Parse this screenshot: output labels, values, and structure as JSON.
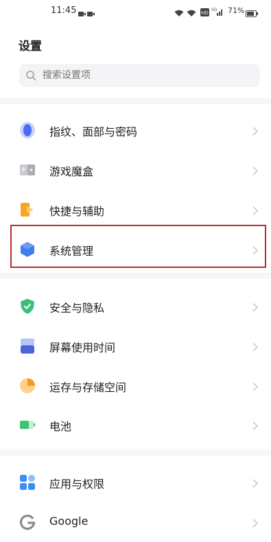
{
  "status_bar": {
    "time": "11:45",
    "battery_percent": "71%",
    "icons": [
      "video-record-icon",
      "wifi-icon",
      "wifi-icon",
      "hd-icon",
      "signal-5g-icon",
      "battery-icon"
    ]
  },
  "header": {
    "title": "设置"
  },
  "search": {
    "placeholder": "搜索设置项"
  },
  "groups": [
    {
      "items": [
        {
          "label": "指纹、面部与密码",
          "icon": "fingerprint-icon"
        },
        {
          "label": "游戏魔盒",
          "icon": "game-box-icon"
        },
        {
          "label": "快捷与辅助",
          "icon": "shortcut-assist-icon"
        },
        {
          "label": "系统管理",
          "icon": "system-management-icon",
          "highlighted": true
        }
      ]
    },
    {
      "items": [
        {
          "label": "安全与隐私",
          "icon": "shield-icon"
        },
        {
          "label": "屏幕使用时间",
          "icon": "screen-time-icon"
        },
        {
          "label": "运存与存储空间",
          "icon": "storage-pie-icon"
        },
        {
          "label": "电池",
          "icon": "battery-icon"
        }
      ]
    },
    {
      "items": [
        {
          "label": "应用与权限",
          "icon": "apps-grid-icon"
        },
        {
          "label": "Google",
          "icon": "google-icon"
        }
      ]
    }
  ],
  "colors": {
    "highlight_border": "#b72c2c",
    "accent_blue": "#3f7df0",
    "divider": "#f6f6f8"
  }
}
